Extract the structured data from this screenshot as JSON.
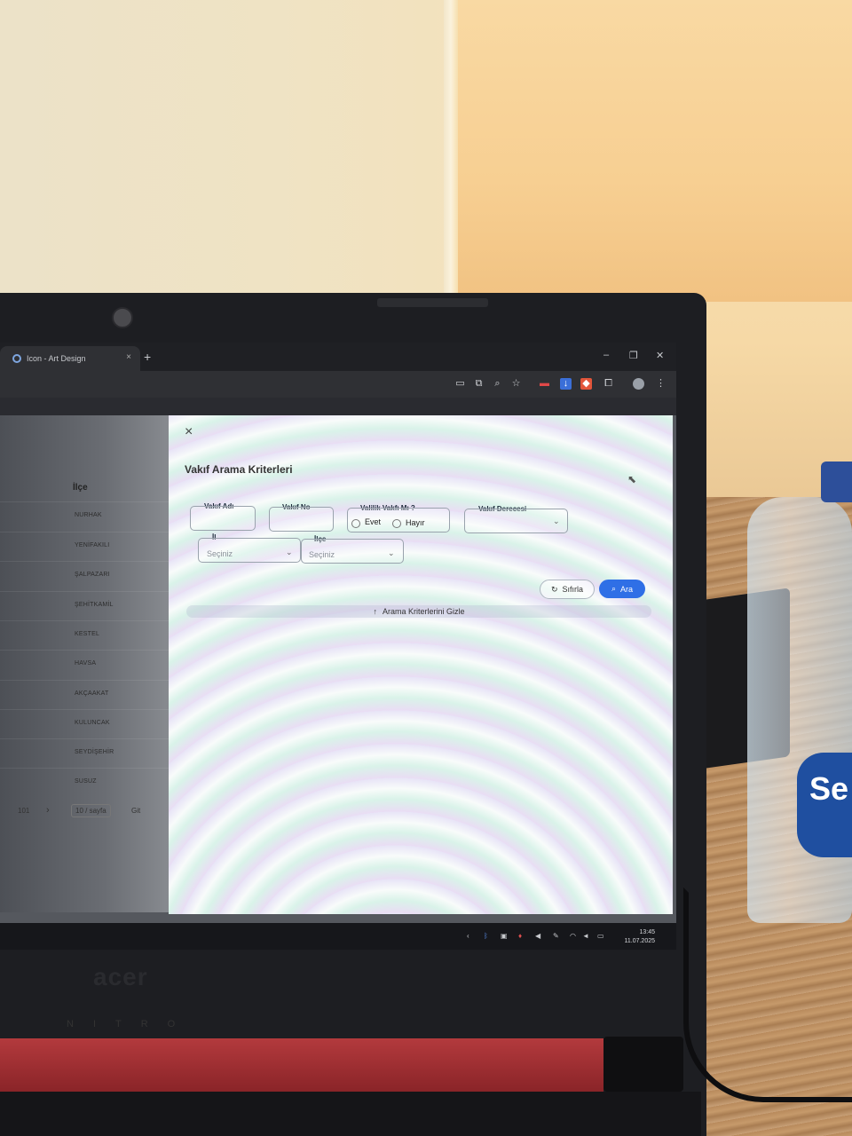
{
  "browser": {
    "tab_title": "Icon - Art Design",
    "new_tab": "+",
    "tab_close": "×",
    "window_controls": [
      "–",
      "❐",
      "✕"
    ],
    "toolbar_icons": [
      "cast-icon",
      "translate-icon",
      "zoom-icon",
      "star-icon",
      "extension-red-icon",
      "extension-blue-icon",
      "extension-orange-icon",
      "extensions-icon",
      "profile-icon",
      "menu-icon"
    ]
  },
  "list": {
    "column_header": "İlçe",
    "rows": [
      "NURHAK",
      "YENİFAKILI",
      "ŞALPAZARI",
      "ŞEHİTKAMİL",
      "KESTEL",
      "HAVSA",
      "AKÇAAKAT",
      "KULUNCAK",
      "SEYDİŞEHİR",
      "SUSUZ"
    ],
    "pager": {
      "page_count": "101",
      "next": "›",
      "page_size": "10 / sayfa",
      "goto_label": "Git"
    }
  },
  "modal": {
    "close_icon": "×",
    "title": "Vakıf Arama Kriterleri",
    "fields": {
      "vakif_adi_label": "Vakıf Adı",
      "vakif_no_label": "Vakıf No",
      "valilik_label": "Valilik Vakfı Mı ?",
      "evet": "Evet",
      "hayir": "Hayır",
      "vakif_derecesi_label": "Vakıf Derecesi",
      "il_label": "İl",
      "il_placeholder": "Seçiniz",
      "ilce_label": "İlçe",
      "ilce_placeholder": "Seçiniz"
    },
    "buttons": {
      "reset": "Sıfırla",
      "search": "Ara"
    },
    "collapse_label": "Arama Kriterlerini Gizle"
  },
  "taskbar": {
    "time": "13:45",
    "date": "11.07.2025"
  },
  "hardware": {
    "brand": "acer",
    "series": "NITRO",
    "bottle_text": "Se"
  },
  "colors": {
    "accent": "#2f6fe6",
    "bottle_label": "#1f4fa0"
  }
}
